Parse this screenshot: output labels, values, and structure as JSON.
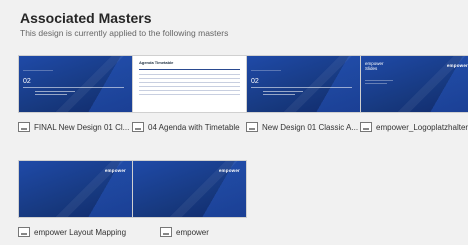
{
  "header": {
    "title": "Associated Masters",
    "subtitle": "This design is currently applied to the following masters"
  },
  "masters": [
    {
      "name": "FINAL New Design 01 Cl...",
      "thumb": "blue-title",
      "number": "02"
    },
    {
      "name": "04 Agenda with Timetable",
      "thumb": "white-agenda",
      "heading": "Agenda Timetable"
    },
    {
      "name": "New Design 01 Classic A...",
      "thumb": "blue-title",
      "number": "02"
    },
    {
      "name": "empower_Logoplatzhalter",
      "thumb": "blue-brand",
      "brand": "empower",
      "slide": "Slides"
    },
    {
      "name": "empower Layout Mapping",
      "thumb": "blue-plain",
      "brand": "empower"
    },
    {
      "name": "empower",
      "thumb": "blue-plain",
      "brand": "empower"
    }
  ],
  "colors": {
    "background": "#f1f1f1",
    "thumb_blue": "#163a8c",
    "accent": "#1f4aa8"
  },
  "icons": {
    "caption": "slide-layout-icon"
  }
}
